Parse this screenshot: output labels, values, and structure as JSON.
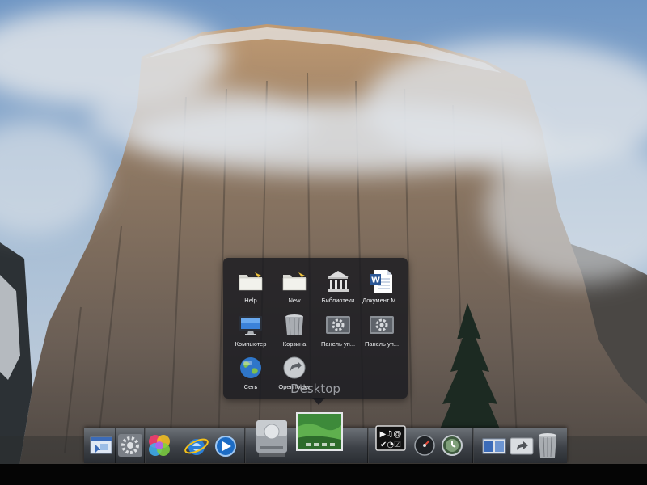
{
  "stack": {
    "title": "Desktop",
    "items": [
      {
        "label": "Help",
        "icon": "folder-icon"
      },
      {
        "label": "New",
        "icon": "folder-icon"
      },
      {
        "label": "Библиотеки",
        "icon": "library-icon"
      },
      {
        "label": "Документ M...",
        "icon": "word-document-icon"
      },
      {
        "label": "Компьютер",
        "icon": "computer-icon"
      },
      {
        "label": "Корзина",
        "icon": "trash-icon"
      },
      {
        "label": "Панель уп...",
        "icon": "control-panel-icon"
      },
      {
        "label": "Панель уп...",
        "icon": "control-panel-icon"
      },
      {
        "label": "Сеть",
        "icon": "network-globe-icon"
      },
      {
        "label": "Open folder",
        "icon": "open-folder-icon"
      }
    ]
  },
  "dock": {
    "items": [
      {
        "icon": "finder-icon"
      },
      {
        "icon": "system-preferences-icon"
      },
      {
        "icon": "color-circles-icon"
      },
      {
        "icon": "internet-explorer-icon"
      },
      {
        "icon": "media-player-icon"
      },
      {
        "icon": "hard-drive-icon"
      },
      {
        "icon": "desktop-stack-icon"
      },
      {
        "icon": "widgets-icon"
      },
      {
        "icon": "dashboard-gauge-icon"
      },
      {
        "icon": "time-machine-icon"
      },
      {
        "icon": "show-desktop-icon"
      },
      {
        "icon": "share-icon"
      },
      {
        "icon": "trash-icon"
      }
    ],
    "widgets_glyphs": "▶♫@ ✔◔☑"
  },
  "colors": {
    "sky": "#8fb2d6",
    "rock": "#7d6b5a",
    "stack_bg": "#16181e",
    "dock_top": "#6b7076"
  }
}
